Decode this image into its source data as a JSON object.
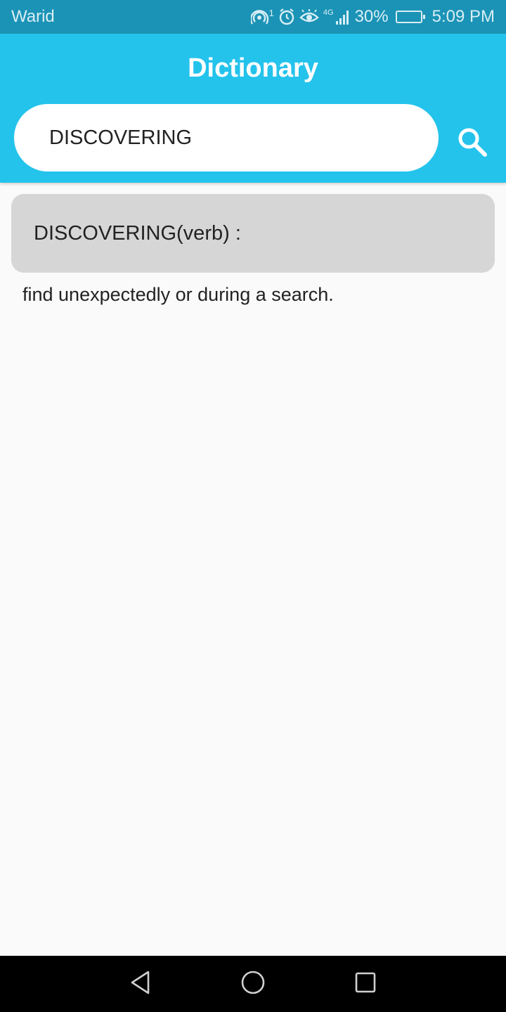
{
  "status_bar": {
    "carrier": "Warid",
    "hotspot_badge": "1",
    "network_type": "4G",
    "battery_percent": "30%",
    "battery_level": 0.3,
    "time": "5:09 PM",
    "icons": [
      "hotspot-icon",
      "alarm-icon",
      "eye-comfort-icon",
      "signal-icon",
      "battery-icon"
    ]
  },
  "app_bar": {
    "title": "Dictionary",
    "color": "#24c3ec"
  },
  "search": {
    "value": "DISCOVERING",
    "button_icon": "search-icon"
  },
  "result": {
    "heading": "DISCOVERING(verb) :",
    "definition": "find unexpectedly or during a search."
  },
  "nav_bar": {
    "buttons": [
      "back-icon",
      "home-icon",
      "recents-icon"
    ]
  }
}
